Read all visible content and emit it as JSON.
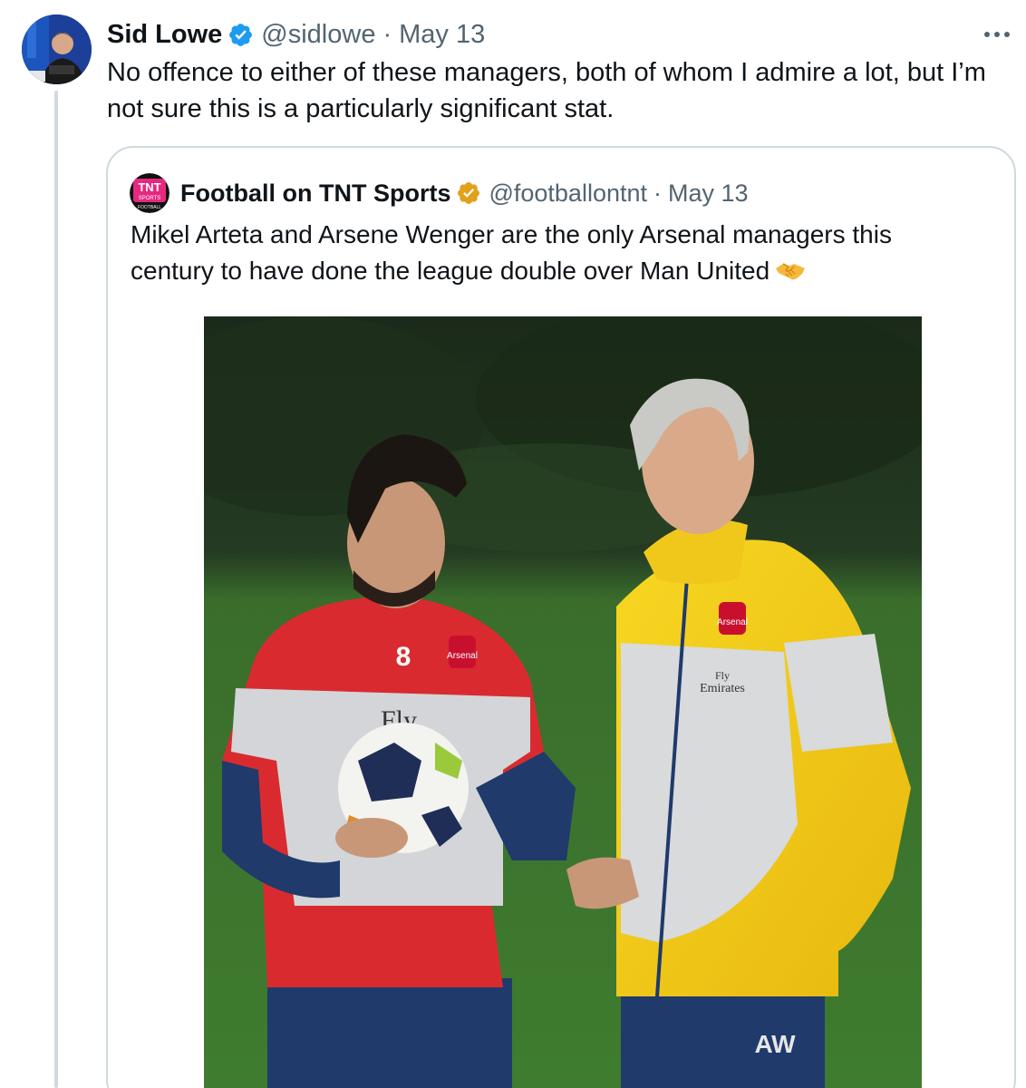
{
  "tweet": {
    "author_name": "Sid Lowe",
    "handle": "@sidlowe",
    "separator": "·",
    "date": "May 13",
    "text": "No offence to either of these managers, both of whom I admire a lot, but I’m not sure this is a particularly significant stat.",
    "icons": {
      "verified": "verified-badge-icon",
      "more": "more-options-icon"
    },
    "colors": {
      "verified": "#1d9bf0",
      "secondary_text": "#536471",
      "border": "#cfd9de"
    }
  },
  "quoted_tweet": {
    "author_name": "Football on TNT Sports",
    "handle": "@footballontnt",
    "separator": "·",
    "date": "May 13",
    "text": "Mikel Arteta and Arsene Wenger are the only Arsenal managers this century to have done the league double over Man United",
    "emoji": "handshake-icon",
    "avatar_logo": {
      "line1": "TNT",
      "line2": "SPORTS",
      "line3": "FOOTBALL"
    },
    "colors": {
      "verified": "#e2a11b",
      "logo_pink": "#e6287f"
    }
  },
  "photo": {
    "shirt_number": "8",
    "sponsor_line1": "Fly",
    "sponsor_line2": "Emirates",
    "initials": "AW",
    "crest": "Arsenal"
  }
}
